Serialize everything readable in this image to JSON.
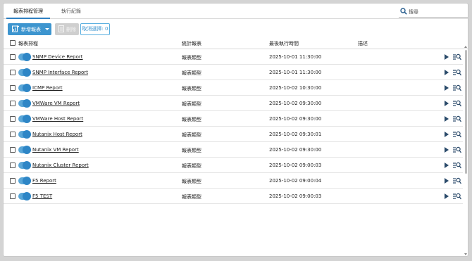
{
  "tabs": [
    {
      "label": "報表排程管理",
      "active": true
    },
    {
      "label": "執行紀錄",
      "active": false
    }
  ],
  "search": {
    "placeholder": "搜尋",
    "icon": "search-icon"
  },
  "toolbar": {
    "add_label": "新增報表",
    "delete_label": "刪除",
    "cancel_label": "取消選擇: 0"
  },
  "columns": {
    "schedule": "報表排程",
    "stat": "統計報表",
    "last_run": "最後執行時間",
    "desc": "描述"
  },
  "rows": [
    {
      "name": "SNMP Device Report",
      "type": "報表類型",
      "time": "2025-10-01 11:30:00",
      "desc": "",
      "enabled": true
    },
    {
      "name": "SNMP Interface Report",
      "type": "報表類型",
      "time": "2025-10-01 11:30:00",
      "desc": "",
      "enabled": true
    },
    {
      "name": "ICMP Report",
      "type": "報表類型",
      "time": "2025-10-02 10:30:00",
      "desc": "",
      "enabled": true
    },
    {
      "name": "VMWare VM Report",
      "type": "報表類型",
      "time": "2025-10-02 09:30:00",
      "desc": "",
      "enabled": true
    },
    {
      "name": "VMWare Host Report",
      "type": "報表類型",
      "time": "2025-10-02 09:30:00",
      "desc": "",
      "enabled": true
    },
    {
      "name": "Nutanix Host Report",
      "type": "報表類型",
      "time": "2025-10-02 09:30:01",
      "desc": "",
      "enabled": true
    },
    {
      "name": "Nutanix VM Report",
      "type": "報表類型",
      "time": "2025-10-02 09:30:00",
      "desc": "",
      "enabled": true
    },
    {
      "name": "Nutanix Cluster Report",
      "type": "報表類型",
      "time": "2025-10-02 09:00:03",
      "desc": "",
      "enabled": true
    },
    {
      "name": "F5 Report",
      "type": "報表類型",
      "time": "2025-10-02 09:00:04",
      "desc": "",
      "enabled": true
    },
    {
      "name": "F5 TEST",
      "type": "報表類型",
      "time": "2025-10-02 09:00:03",
      "desc": "",
      "enabled": true
    }
  ],
  "colors": {
    "accent": "#3d95cf",
    "toggle_on": "#2e86c6",
    "play": "#2a4a6a"
  }
}
